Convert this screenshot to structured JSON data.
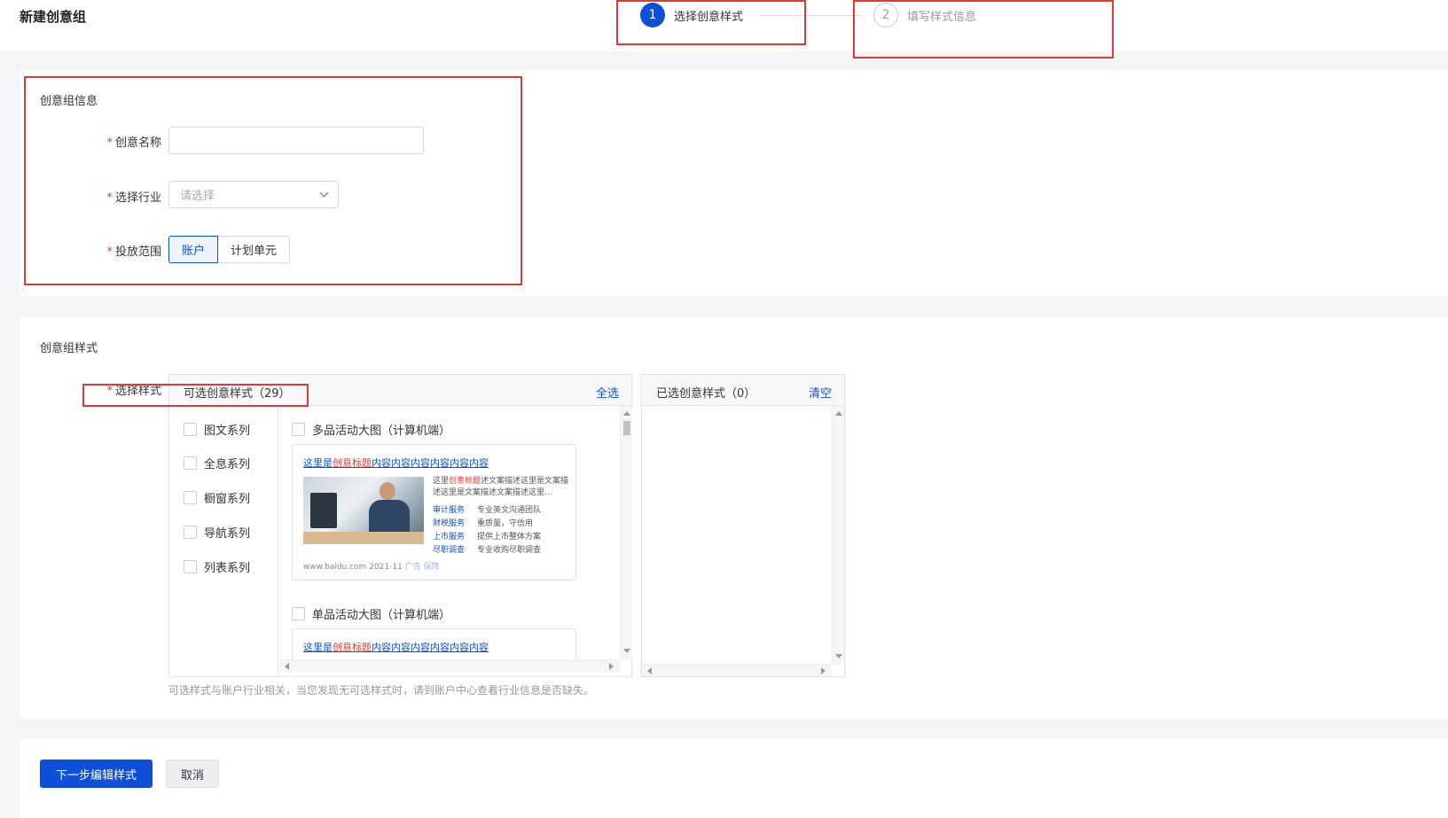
{
  "page": {
    "title": "新建创意组"
  },
  "steps": [
    {
      "num": "1",
      "label": "选择创意样式"
    },
    {
      "num": "2",
      "label": "填写样式信息"
    }
  ],
  "info": {
    "section_title": "创意组信息",
    "name_label": "创意名称",
    "industry_label": "选择行业",
    "industry_placeholder": "请选择",
    "scope_label": "投放范围",
    "scope_options": [
      "账户",
      "计划单元"
    ]
  },
  "style": {
    "section_title": "创意组样式",
    "select_label": "选择样式",
    "available_title": "可选创意样式（29）",
    "select_all": "全选",
    "selected_title": "已选创意样式（0）",
    "clear": "清空",
    "categories": [
      "图文系列",
      "全息系列",
      "橱窗系列",
      "导航系列",
      "列表系列"
    ],
    "items": [
      {
        "name": "多品活动大图（计算机端）"
      },
      {
        "name": "单品活动大图（计算机端）"
      }
    ],
    "preview": {
      "title_pre": "这里是",
      "title_hl": "创意标题",
      "title_post": "内容内容内容内容内容内容",
      "desc_pre": "这里",
      "desc_hl": "创意标题",
      "desc_post": "述文案描述这里是文案描述这里是文案描述文案描述这里...",
      "services": [
        {
          "k": "审计服务",
          "v": "专业英文沟通团队"
        },
        {
          "k": "财税服务",
          "v": "重质量，守信用"
        },
        {
          "k": "上市服务",
          "v": "提供上市整体方案"
        },
        {
          "k": "尽职调查",
          "v": "专业收购尽职调查"
        }
      ],
      "footer": "www.baidu.com 2021-11",
      "ad_label": "广告",
      "badge": "保障"
    },
    "hint": "可选样式与账户行业相关，当您发现无可选样式时，请到账户中心查看行业信息是否缺失。"
  },
  "footer": {
    "next_button": "下一步编辑样式",
    "cancel_button": "取消"
  },
  "colors": {
    "primary": "#0d4fd6",
    "required": "#e53935",
    "annotation": "#e53935"
  }
}
